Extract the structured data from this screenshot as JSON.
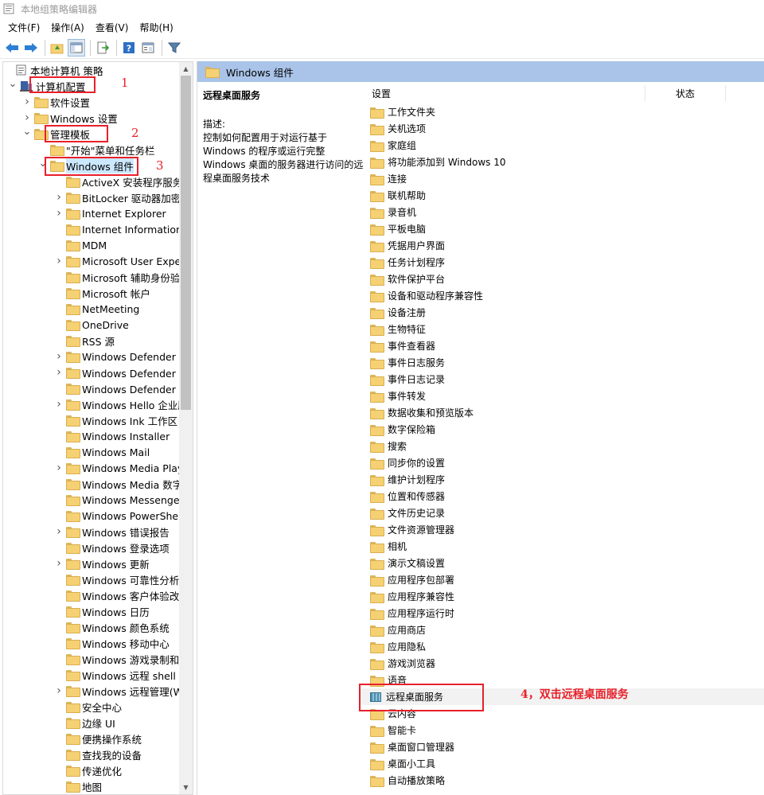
{
  "window": {
    "title": "本地组策略编辑器"
  },
  "menu": [
    "文件(F)",
    "操作(A)",
    "查看(V)",
    "帮助(H)"
  ],
  "toolbar": {
    "buttons": [
      "back-icon",
      "forward-icon",
      "up-folder-icon",
      "show-hide-tree-icon",
      "export-list-icon",
      "help-icon",
      "properties-icon",
      "filter-icon"
    ]
  },
  "tree": {
    "root": "本地计算机 策略",
    "items": [
      {
        "label": "本地计算机 策略",
        "level": 0,
        "arrow": "",
        "icon": "policy-root-icon"
      },
      {
        "label": "计算机配置",
        "level": 1,
        "arrow": "expanded",
        "icon": "computer-icon"
      },
      {
        "label": "软件设置",
        "level": 2,
        "arrow": "collapsed",
        "icon": "folder-icon"
      },
      {
        "label": "Windows 设置",
        "level": 2,
        "arrow": "collapsed",
        "icon": "folder-icon"
      },
      {
        "label": "管理模板",
        "level": 2,
        "arrow": "expanded",
        "icon": "folder-icon"
      },
      {
        "label": "\"开始\"菜单和任务栏",
        "level": 3,
        "arrow": "",
        "icon": "folder-icon"
      },
      {
        "label": "Windows 组件",
        "level": 3,
        "arrow": "expanded",
        "icon": "folder-icon",
        "selected": true
      },
      {
        "label": "ActiveX 安装程序服务",
        "level": 4,
        "arrow": "",
        "icon": "folder-icon"
      },
      {
        "label": "BitLocker 驱动器加密",
        "level": 4,
        "arrow": "collapsed",
        "icon": "folder-icon"
      },
      {
        "label": "Internet Explorer",
        "level": 4,
        "arrow": "collapsed",
        "icon": "folder-icon"
      },
      {
        "label": "Internet Information S",
        "level": 4,
        "arrow": "",
        "icon": "folder-icon"
      },
      {
        "label": "MDM",
        "level": 4,
        "arrow": "",
        "icon": "folder-icon"
      },
      {
        "label": "Microsoft User Exper",
        "level": 4,
        "arrow": "collapsed",
        "icon": "folder-icon"
      },
      {
        "label": "Microsoft 辅助身份验证",
        "level": 4,
        "arrow": "",
        "icon": "folder-icon"
      },
      {
        "label": "Microsoft 帐户",
        "level": 4,
        "arrow": "",
        "icon": "folder-icon"
      },
      {
        "label": "NetMeeting",
        "level": 4,
        "arrow": "",
        "icon": "folder-icon"
      },
      {
        "label": "OneDrive",
        "level": 4,
        "arrow": "",
        "icon": "folder-icon"
      },
      {
        "label": "RSS 源",
        "level": 4,
        "arrow": "",
        "icon": "folder-icon"
      },
      {
        "label": "Windows Defender S",
        "level": 4,
        "arrow": "collapsed",
        "icon": "folder-icon"
      },
      {
        "label": "Windows Defender 防",
        "level": 4,
        "arrow": "collapsed",
        "icon": "folder-icon"
      },
      {
        "label": "Windows Defender 应",
        "level": 4,
        "arrow": "",
        "icon": "folder-icon"
      },
      {
        "label": "Windows Hello 企业版",
        "level": 4,
        "arrow": "collapsed",
        "icon": "folder-icon"
      },
      {
        "label": "Windows Ink 工作区",
        "level": 4,
        "arrow": "",
        "icon": "folder-icon"
      },
      {
        "label": "Windows Installer",
        "level": 4,
        "arrow": "",
        "icon": "folder-icon"
      },
      {
        "label": "Windows Mail",
        "level": 4,
        "arrow": "",
        "icon": "folder-icon"
      },
      {
        "label": "Windows Media Playe",
        "level": 4,
        "arrow": "collapsed",
        "icon": "folder-icon"
      },
      {
        "label": "Windows Media 数字",
        "level": 4,
        "arrow": "",
        "icon": "folder-icon"
      },
      {
        "label": "Windows Messenger",
        "level": 4,
        "arrow": "",
        "icon": "folder-icon"
      },
      {
        "label": "Windows PowerShell",
        "level": 4,
        "arrow": "",
        "icon": "folder-icon"
      },
      {
        "label": "Windows 错误报告",
        "level": 4,
        "arrow": "collapsed",
        "icon": "folder-icon"
      },
      {
        "label": "Windows 登录选项",
        "level": 4,
        "arrow": "",
        "icon": "folder-icon"
      },
      {
        "label": "Windows 更新",
        "level": 4,
        "arrow": "collapsed",
        "icon": "folder-icon"
      },
      {
        "label": "Windows 可靠性分析",
        "level": 4,
        "arrow": "",
        "icon": "folder-icon"
      },
      {
        "label": "Windows 客户体验改善",
        "level": 4,
        "arrow": "",
        "icon": "folder-icon"
      },
      {
        "label": "Windows 日历",
        "level": 4,
        "arrow": "",
        "icon": "folder-icon"
      },
      {
        "label": "Windows 颜色系统",
        "level": 4,
        "arrow": "",
        "icon": "folder-icon"
      },
      {
        "label": "Windows 移动中心",
        "level": 4,
        "arrow": "",
        "icon": "folder-icon"
      },
      {
        "label": "Windows 游戏录制和广",
        "level": 4,
        "arrow": "",
        "icon": "folder-icon"
      },
      {
        "label": "Windows 远程 shell",
        "level": 4,
        "arrow": "",
        "icon": "folder-icon"
      },
      {
        "label": "Windows 远程管理(Wi",
        "level": 4,
        "arrow": "collapsed",
        "icon": "folder-icon"
      },
      {
        "label": "安全中心",
        "level": 4,
        "arrow": "",
        "icon": "folder-icon"
      },
      {
        "label": "边缘 UI",
        "level": 4,
        "arrow": "",
        "icon": "folder-icon"
      },
      {
        "label": "便携操作系统",
        "level": 4,
        "arrow": "",
        "icon": "folder-icon"
      },
      {
        "label": "查找我的设备",
        "level": 4,
        "arrow": "",
        "icon": "folder-icon"
      },
      {
        "label": "传递优化",
        "level": 4,
        "arrow": "",
        "icon": "folder-icon"
      },
      {
        "label": "地图",
        "level": 4,
        "arrow": "",
        "icon": "folder-icon"
      }
    ]
  },
  "right_pane": {
    "header": "Windows 组件",
    "description": {
      "title": "远程桌面服务",
      "label": "描述:",
      "text": "控制如何配置用于对运行基于 Windows 的程序或运行完整 Windows 桌面的服务器进行访问的远程桌面服务技术"
    },
    "columns": {
      "setting": "设置",
      "state": "状态"
    },
    "items": [
      "工作文件夹",
      "关机选项",
      "家庭组",
      "将功能添加到 Windows 10",
      "连接",
      "联机帮助",
      "录音机",
      "平板电脑",
      "凭据用户界面",
      "任务计划程序",
      "软件保护平台",
      "设备和驱动程序兼容性",
      "设备注册",
      "生物特征",
      "事件查看器",
      "事件日志服务",
      "事件日志记录",
      "事件转发",
      "数据收集和预览版本",
      "数字保险箱",
      "搜索",
      "同步你的设置",
      "维护计划程序",
      "位置和传感器",
      "文件历史记录",
      "文件资源管理器",
      "相机",
      "演示文稿设置",
      "应用程序包部署",
      "应用程序兼容性",
      "应用程序运行时",
      "应用商店",
      "应用隐私",
      "游戏浏览器",
      "语音",
      "远程桌面服务",
      "云内容",
      "智能卡",
      "桌面窗口管理器",
      "桌面小工具",
      "自动播放策略"
    ],
    "highlighted_item": "远程桌面服务"
  },
  "annotations": {
    "step1": "1",
    "step2": "2",
    "step3": "3",
    "step4": "4，双击远程桌面服务",
    "color": "#e8202a"
  }
}
